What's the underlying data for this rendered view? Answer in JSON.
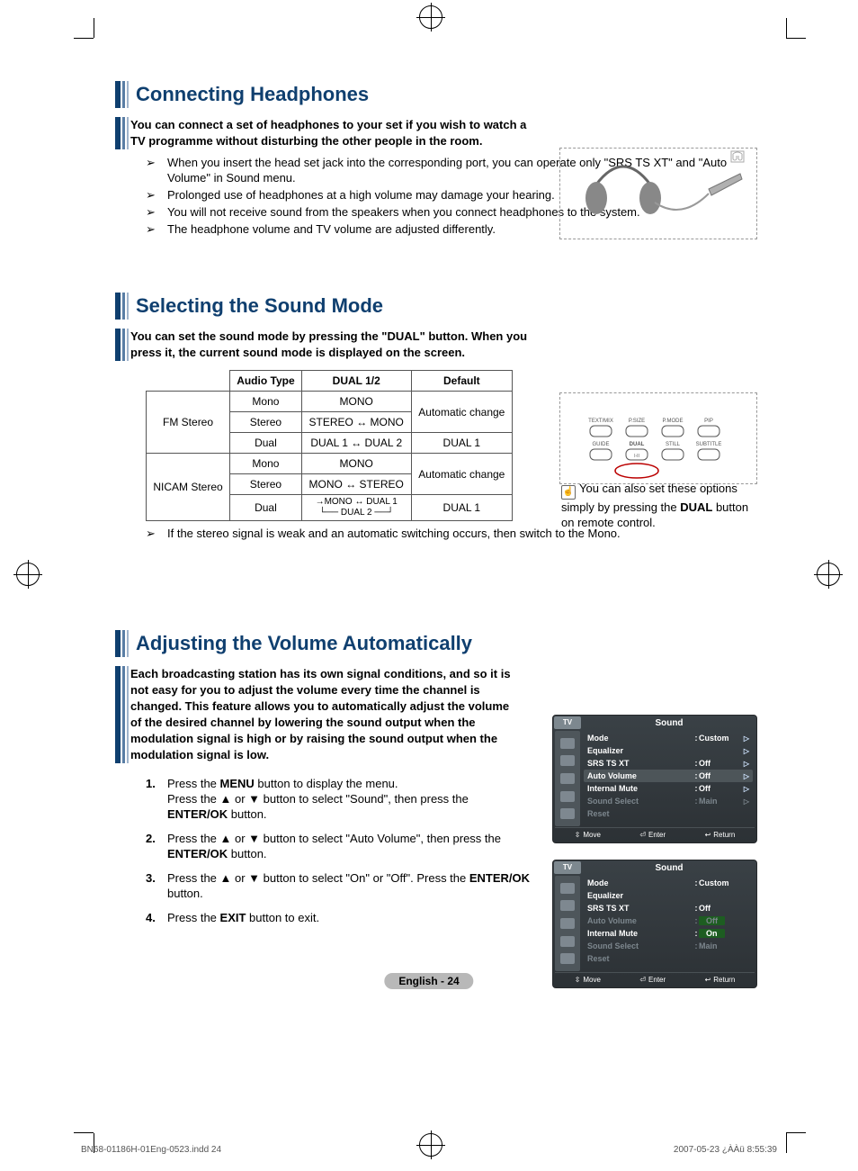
{
  "sections": {
    "s1": {
      "title": "Connecting Headphones",
      "intro": "You can connect a set of headphones to your set if you wish to watch a TV programme without disturbing the other people in the room.",
      "items": [
        "When you insert the head set jack into the corresponding port, you can operate only \"SRS TS XT\" and \"Auto Volume\" in Sound menu.",
        "Prolonged use of headphones at a high volume may damage your hearing.",
        "You will not receive sound from the speakers when you connect headphones to the system.",
        "The headphone volume and TV volume  are adjusted differently."
      ]
    },
    "s2": {
      "title": "Selecting the Sound Mode",
      "intro": "You can set the sound mode by pressing the \"DUAL\" button. When you press it, the current sound mode is displayed on the screen.",
      "note_after_table": "If the stereo signal is weak and an automatic switching occurs, then switch to the Mono.",
      "remote_note_pre": "You can also set these options simply by pressing the ",
      "remote_note_bold": "DUAL",
      "remote_note_post": " button on remote control.",
      "remote_labels": {
        "top": [
          "TEXT/MIX",
          "P.SIZE",
          "P.MODE",
          "PIP"
        ],
        "bottom": [
          "GUIDE",
          "DUAL",
          "STILL",
          "SUBTITLE"
        ]
      },
      "table_headers": {
        "audio_type": "Audio Type",
        "dual": "DUAL 1/2",
        "default": "Default"
      },
      "table": [
        {
          "group": "FM Stereo",
          "audio": "Mono",
          "dual": "MONO",
          "def": "Automatic change"
        },
        {
          "group": "",
          "audio": "Stereo",
          "dual": "STEREO ↔ MONO",
          "def": ""
        },
        {
          "group": "",
          "audio": "Dual",
          "dual": "DUAL 1 ↔ DUAL 2",
          "def": "DUAL 1"
        },
        {
          "group": "NICAM Stereo",
          "audio": "Mono",
          "dual": "MONO",
          "def": "Automatic change"
        },
        {
          "group": "",
          "audio": "Stereo",
          "dual": "MONO ↔ STEREO",
          "def": ""
        },
        {
          "group": "",
          "audio": "Dual",
          "dual": "MONO ↔ DUAL 1\nDUAL 2",
          "def": "DUAL 1"
        }
      ]
    },
    "s3": {
      "title": "Adjusting the Volume Automatically",
      "intro": "Each broadcasting station has its own signal conditions, and so it is not easy for you to adjust the volume every time the channel is changed. This feature allows you to automatically adjust the volume of the desired channel by lowering the sound output when the modulation signal is high or by raising the sound output when the modulation signal is low.",
      "steps": [
        "Press the MENU button to display the menu.\nPress the ▲ or ▼ button to select \"Sound\", then press the ENTER/OK button.",
        "Press the ▲ or ▼ button to select \"Auto Volume\", then press the ENTER/OK button.",
        "Press the ▲ or ▼ button to select \"On\" or \"Off\". Press the ENTER/OK button.",
        "Press the EXIT button to exit."
      ]
    }
  },
  "osd": {
    "tv_badge": "TV",
    "title": "Sound",
    "footer": {
      "move": "Move",
      "enter": "Enter",
      "return": "Return"
    },
    "menu1": {
      "rows": [
        {
          "label": "Mode",
          "val": "Custom",
          "arrow": true,
          "sel": false,
          "dim": false
        },
        {
          "label": "Equalizer",
          "val": "",
          "arrow": true,
          "sel": false,
          "dim": false
        },
        {
          "label": "SRS TS XT",
          "val": "Off",
          "arrow": true,
          "sel": false,
          "dim": false
        },
        {
          "label": "Auto Volume",
          "val": "Off",
          "arrow": true,
          "sel": true,
          "dim": false
        },
        {
          "label": "Internal Mute",
          "val": "Off",
          "arrow": true,
          "sel": false,
          "dim": false
        },
        {
          "label": "Sound Select",
          "val": "Main",
          "arrow": true,
          "sel": false,
          "dim": true
        },
        {
          "label": "Reset",
          "val": "",
          "arrow": false,
          "sel": false,
          "dim": true
        }
      ]
    },
    "menu2": {
      "rows": [
        {
          "label": "Mode",
          "val": "Custom",
          "arrow": false,
          "sel": false,
          "dim": false
        },
        {
          "label": "Equalizer",
          "val": "",
          "arrow": false,
          "sel": false,
          "dim": false
        },
        {
          "label": "SRS TS XT",
          "val": "Off",
          "arrow": false,
          "sel": false,
          "dim": false
        },
        {
          "label": "Auto Volume",
          "val": "Off",
          "arrow": false,
          "sel": false,
          "dim": true,
          "hl": true
        },
        {
          "label": "Internal Mute",
          "val": "On",
          "arrow": false,
          "sel": false,
          "dim": false,
          "hl": true
        },
        {
          "label": "Sound Select",
          "val": "Main",
          "arrow": false,
          "sel": false,
          "dim": true
        },
        {
          "label": "Reset",
          "val": "",
          "arrow": false,
          "sel": false,
          "dim": true
        }
      ],
      "option_off": "Off",
      "option_on": "On"
    }
  },
  "page_label": "English - 24",
  "doc_footer": {
    "left": "BN68-01186H-01Eng-0523.indd   24",
    "right": "2007-05-23   ¿ÀÀü 8:55:39"
  }
}
